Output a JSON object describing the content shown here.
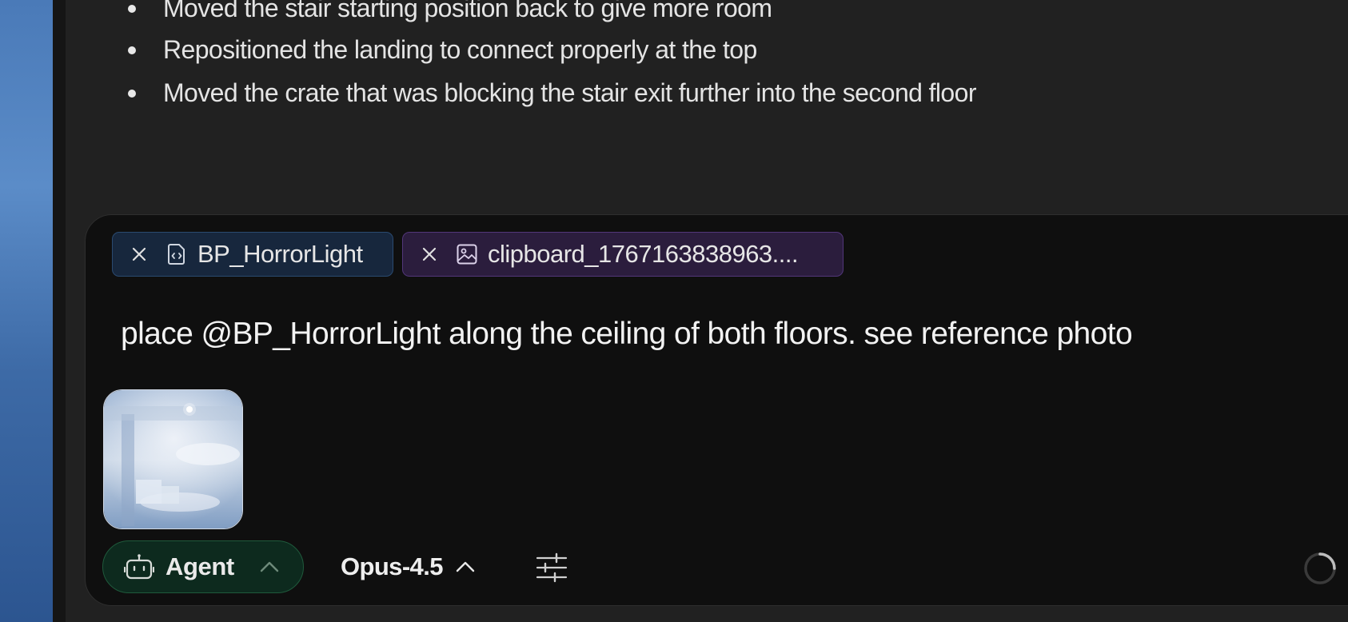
{
  "messages": {
    "bullets": [
      "Moved the stair starting position back to give more room",
      "Repositioned the landing to connect properly at the top",
      "Moved the crate that was blocking the stair exit further into the second floor"
    ]
  },
  "composer": {
    "attachments": [
      {
        "label": "BP_HorrorLight",
        "icon": "blueprint-file-icon",
        "color": "#17273d"
      },
      {
        "label": "clipboard_1767163838963....",
        "icon": "image-icon",
        "color": "#2b1d3d"
      }
    ],
    "prompt_text": "place @BP_HorrorLight along the ceiling of both floors. see reference photo",
    "image_thumbnail": "reference-photo",
    "mode_label": "Agent",
    "mode_color": "#0d2a1e",
    "model_label": "Opus-4.5",
    "icons": [
      "close-icon",
      "robot-icon",
      "chevron-up-icon",
      "sliders-icon",
      "loading-spinner-icon"
    ]
  }
}
